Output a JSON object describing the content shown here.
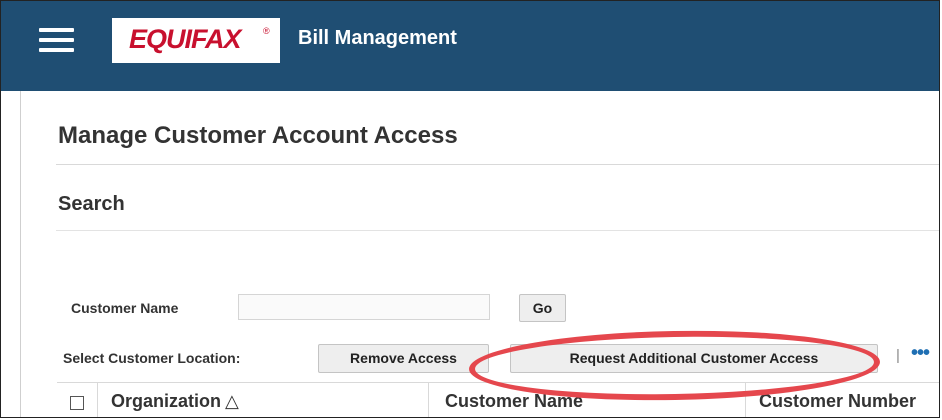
{
  "header": {
    "brand": "EQUIFAX",
    "brand_mark": "®",
    "app_title": "Bill Management",
    "menu_icon": "hamburger-menu-icon",
    "background_color": "#1f4e73"
  },
  "page": {
    "title": "Manage Customer Account Access"
  },
  "search": {
    "section_title": "Search",
    "customer_name_label": "Customer Name",
    "customer_name_value": "",
    "go_label": "Go"
  },
  "toolbar": {
    "select_location_label": "Select Customer Location:",
    "remove_access_label": "Remove Access",
    "request_access_label": "Request Additional Customer Access",
    "separator": "|",
    "more_label": "•••"
  },
  "table": {
    "columns": [
      "Organization",
      "Customer Name",
      "Customer Number"
    ],
    "sort_indicator": "△"
  },
  "annotation": {
    "highlight_color": "#e5474d"
  }
}
